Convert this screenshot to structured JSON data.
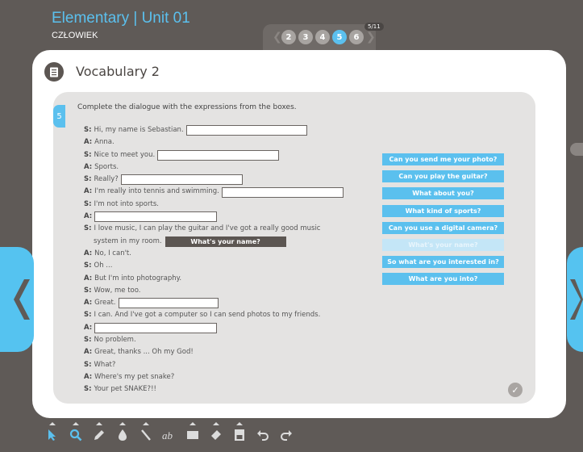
{
  "header": {
    "title": "Elementary | Unit 01",
    "subtitle": "CZŁOWIEK"
  },
  "pager": {
    "pages": [
      "2",
      "3",
      "4",
      "5",
      "6"
    ],
    "active": "5",
    "counter": "5/11"
  },
  "section": {
    "title": "Vocabulary 2"
  },
  "exercise": {
    "number": "5",
    "instruction": "Complete the dialogue with the expressions from the boxes.",
    "lines": [
      {
        "speaker": "S:",
        "text": "Hi, my name is Sebastian."
      },
      {
        "speaker": "A:",
        "text": "Anna."
      },
      {
        "speaker": "S:",
        "text": "Nice to meet you."
      },
      {
        "speaker": "A:",
        "text": "Sports."
      },
      {
        "speaker": "S:",
        "text": "Really?"
      },
      {
        "speaker": "A:",
        "text": "I'm really into tennis and swimming."
      },
      {
        "speaker": "S:",
        "text": "I'm not into sports."
      },
      {
        "speaker": "A:",
        "text": ""
      },
      {
        "speaker": "S:",
        "text": "I love music, I can play the guitar and I've got a really good music"
      },
      {
        "speaker": "",
        "text": "system in my room."
      },
      {
        "speaker": "A:",
        "text": "No, I can't."
      },
      {
        "speaker": "S:",
        "text": "Oh ..."
      },
      {
        "speaker": "A:",
        "text": "But I'm into photography."
      },
      {
        "speaker": "S:",
        "text": "Wow, me too."
      },
      {
        "speaker": "A:",
        "text": "Great."
      },
      {
        "speaker": "S:",
        "text": "I can. And I've got a computer so I can send photos to my friends."
      },
      {
        "speaker": "A:",
        "text": ""
      },
      {
        "speaker": "S:",
        "text": "No problem."
      },
      {
        "speaker": "A:",
        "text": "Great, thanks ... Oh my God!"
      },
      {
        "speaker": "S:",
        "text": "What?"
      },
      {
        "speaker": "A:",
        "text": "Where's my pet snake?"
      },
      {
        "speaker": "S:",
        "text": "Your pet SNAKE?!!"
      }
    ],
    "placed_answer": "What's your name?",
    "options": [
      "Can you send me your photo?",
      "Can you play the guitar?",
      "What about you?",
      "What kind of sports?",
      "Can you use a digital camera?",
      "What's your name?",
      "So what are you interested in?",
      "What are you into?"
    ],
    "used_option": "What's your name?"
  },
  "colors": {
    "accent": "#5bc0ee",
    "background": "#5f5a57",
    "dark": "#5c5652"
  },
  "toolbar": {
    "tools": [
      "cursor-icon",
      "zoom-icon",
      "pencil-icon",
      "ink-drop-icon",
      "line-icon",
      "text-icon",
      "screen-icon",
      "eraser-icon",
      "save-icon",
      "undo-icon",
      "redo-icon"
    ]
  }
}
